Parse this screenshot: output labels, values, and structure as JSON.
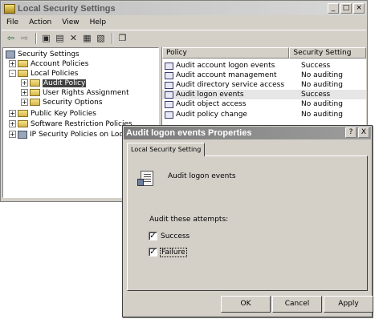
{
  "main_window": {
    "title": "Local Security Settings",
    "menu": [
      "File",
      "Action",
      "View",
      "Help"
    ],
    "toolbar_icons": [
      "back-arrow-icon",
      "forward-arrow-icon",
      "up-folder-icon",
      "show-tree-icon",
      "delete-icon",
      "properties-icon",
      "export-icon",
      "help-icon"
    ]
  },
  "tree": {
    "root": "Security Settings",
    "items": [
      {
        "label": "Account Policies",
        "expander": "+"
      },
      {
        "label": "Local Policies",
        "expander": "-"
      },
      {
        "label": "Audit Policy",
        "expander": "+"
      },
      {
        "label": "User Rights Assignment",
        "expander": "+"
      },
      {
        "label": "Security Options",
        "expander": "+"
      },
      {
        "label": "Public Key Policies",
        "expander": "+"
      },
      {
        "label": "Software Restriction Policies",
        "expander": "+"
      },
      {
        "label": "IP Security Policies on Local Co",
        "expander": "+"
      }
    ]
  },
  "list": {
    "columns": [
      "Policy",
      "Security Setting"
    ],
    "rows": [
      {
        "policy": "Audit account logon events",
        "setting": "Success"
      },
      {
        "policy": "Audit account management",
        "setting": "No auditing"
      },
      {
        "policy": "Audit directory service access",
        "setting": "No auditing"
      },
      {
        "policy": "Audit logon events",
        "setting": "Success"
      },
      {
        "policy": "Audit object access",
        "setting": "No auditing"
      },
      {
        "policy": "Audit policy change",
        "setting": "No auditing"
      }
    ]
  },
  "dialog": {
    "title": "Audit logon events Properties",
    "help_btn": "?",
    "close_btn": "X",
    "tab": "Local Security Setting",
    "policy_name": "Audit logon events",
    "group_label": "Audit these attempts:",
    "checkboxes": [
      {
        "label": "Success",
        "checked": true
      },
      {
        "label": "Failure",
        "checked": true
      }
    ],
    "buttons": {
      "ok": "OK",
      "cancel": "Cancel",
      "apply": "Apply"
    }
  }
}
